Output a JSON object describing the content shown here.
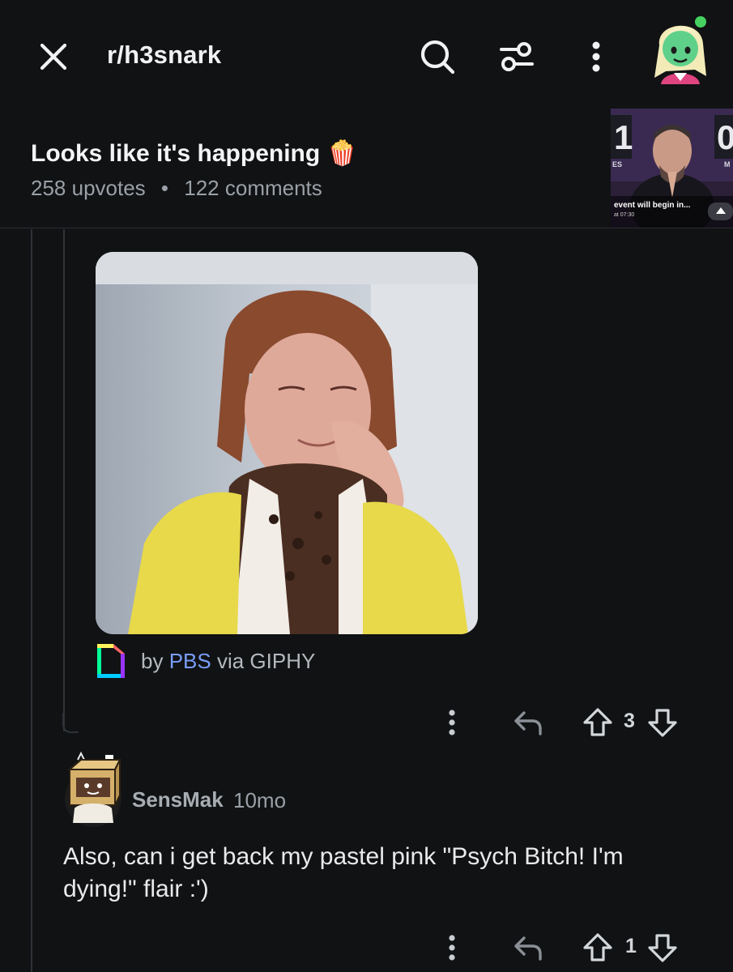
{
  "header": {
    "subreddit": "r/h3snark",
    "icons": [
      "close-icon",
      "search-icon",
      "filter-icon",
      "more-vertical-icon",
      "user-avatar"
    ]
  },
  "post": {
    "title": "Looks like it's happening",
    "title_emoji": "🍿",
    "upvotes": "258 upvotes",
    "separator": "•",
    "comments": "122 comments",
    "thumbnail_text": {
      "top_left": "1",
      "top_right": "0",
      "small_left": "ES",
      "small_right": "M",
      "caption": "event will begin in...",
      "time": "at 07:30"
    }
  },
  "gif_reply": {
    "attribution_by": "by",
    "attribution_source": "PBS",
    "attribution_via": "via GIPHY",
    "vote_count": "3"
  },
  "comment": {
    "username": "SensMak",
    "time": "10mo",
    "body": "Also, can i get back my pastel pink \"Psych Bitch! I'm dying!\" flair :')",
    "vote_count": "1"
  },
  "colors": {
    "background": "#101214",
    "accent_link": "#7a9df7",
    "online": "#46d160",
    "muted_text": "#9aa0a6"
  }
}
